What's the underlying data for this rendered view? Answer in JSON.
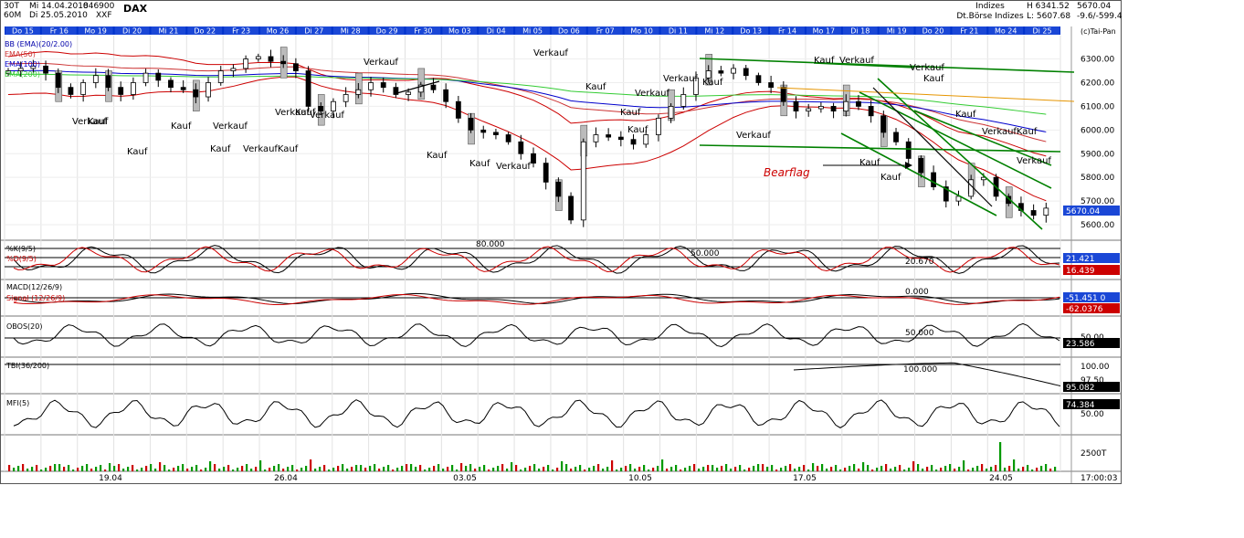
{
  "header": {
    "interval_top": "30T",
    "interval_bottom": "60M",
    "date_from": "Mi 14.04.2010",
    "date_to": "Di 25.05.2010",
    "wkn": "846900",
    "exchange": "XXF",
    "symbol": "DAX",
    "category_top": "Indizes",
    "category_bottom": "Dt.Börse Indizes",
    "high_label": "H  6341.52",
    "low_label": "L: 5607.68",
    "last_price": "5670.04",
    "change": "-9.6/-599.4",
    "provider": "(c)Tai-Pan"
  },
  "day_labels": [
    "Do 15",
    "Fr 16",
    "Mo 19",
    "Di 20",
    "Mi 21",
    "Do 22",
    "Fr 23",
    "Mo 26",
    "Di 27",
    "Mi 28",
    "Do 29",
    "Fr 30",
    "Mo 03",
    "Di 04",
    "Mi 05",
    "Do 06",
    "Fr 07",
    "Mo 10",
    "Di 11",
    "Mi 12",
    "Do 13",
    "Fr 14",
    "Mo 17",
    "Di 18",
    "Mi 19",
    "Do 20",
    "Fr 21",
    "Mo 24",
    "Di 25"
  ],
  "date_axis": [
    "19.04",
    "26.04",
    "03.05",
    "10.05",
    "17.05",
    "24.05"
  ],
  "time_label": "17:00:03",
  "indicators_main": [
    "BB (EMA)(20/2.00)",
    "EMA(50)",
    "EMA(100)",
    "EMA(200)"
  ],
  "signals": [
    "Verkauf",
    "Kauf",
    "Kauf",
    "Kauf",
    "Verkauf",
    "Kauf",
    "VerkaufKauf",
    "Verkauf",
    "Kauf",
    "Verkauf",
    "Verkauf",
    "Kauf",
    "Kauf",
    "Verkauf",
    "Verkauf",
    "Kauf",
    "Verkauf",
    "Kauf",
    "Kauf",
    "Verkauf",
    "Kauf",
    "Verkauf",
    "Kauf",
    "Verkauf",
    "Kauf",
    "Kauf",
    "Verkauf",
    "Kauf",
    "Kauf",
    "VerkaufKauf",
    "Verkauf"
  ],
  "annotation": "Bearflag",
  "colors": {
    "accent": "#0000cc",
    "header_bar": "#0033cc",
    "bull": "#009900",
    "bear": "#cc0000",
    "trend": "#008000"
  },
  "panels": {
    "stoch": {
      "label_k": "%K(9/5)",
      "label_d": "%D(9/5)",
      "lvl1": "80.000",
      "lvl2": "50.000",
      "lvl3": "20.670",
      "box1": "21.421",
      "box2": "16.439"
    },
    "macd": {
      "label1": "MACD(12/26/9)",
      "label2": "Signal (12/26/9)",
      "zero": "0.000",
      "box1": "-51.451 0",
      "box2": "-62.0376"
    },
    "obos": {
      "label": "OBOS(20)",
      "lvl": "50.000",
      "right": "50.00",
      "box": "23.586"
    },
    "tbi": {
      "label": "TBI(36/200)",
      "lvl": "100.000",
      "right": "100.00",
      "right2": "97.50",
      "box": "95.082"
    },
    "mfi": {
      "label": "MFI(5)",
      "right": "50.00",
      "box": "74.384"
    },
    "vol": {
      "right": "2500T"
    }
  },
  "chart_data": {
    "type": "candlestick",
    "title": "DAX",
    "ylim": [
      5550,
      6360
    ],
    "yticks": [
      5600,
      5700,
      5800,
      5900,
      6000,
      6100,
      6200,
      6300
    ],
    "close_series": [
      6250,
      6260,
      6270,
      6240,
      6180,
      6150,
      6200,
      6230,
      6180,
      6150,
      6200,
      6240,
      6210,
      6180,
      6170,
      6140,
      6200,
      6250,
      6260,
      6300,
      6310,
      6290,
      6280,
      6250,
      6100,
      6080,
      6120,
      6150,
      6170,
      6200,
      6180,
      6150,
      6160,
      6190,
      6170,
      6120,
      6050,
      6000,
      5990,
      5980,
      5950,
      5900,
      5860,
      5780,
      5720,
      5620,
      5950,
      5980,
      5970,
      5960,
      5940,
      5980,
      6050,
      6100,
      6150,
      6220,
      6250,
      6240,
      6260,
      6230,
      6200,
      6180,
      6120,
      6080,
      6090,
      6100,
      6080,
      6120,
      6100,
      6060,
      5990,
      5950,
      5880,
      5820,
      5760,
      5700,
      5720,
      5790,
      5800,
      5720,
      5690,
      5660,
      5640,
      5670
    ]
  }
}
